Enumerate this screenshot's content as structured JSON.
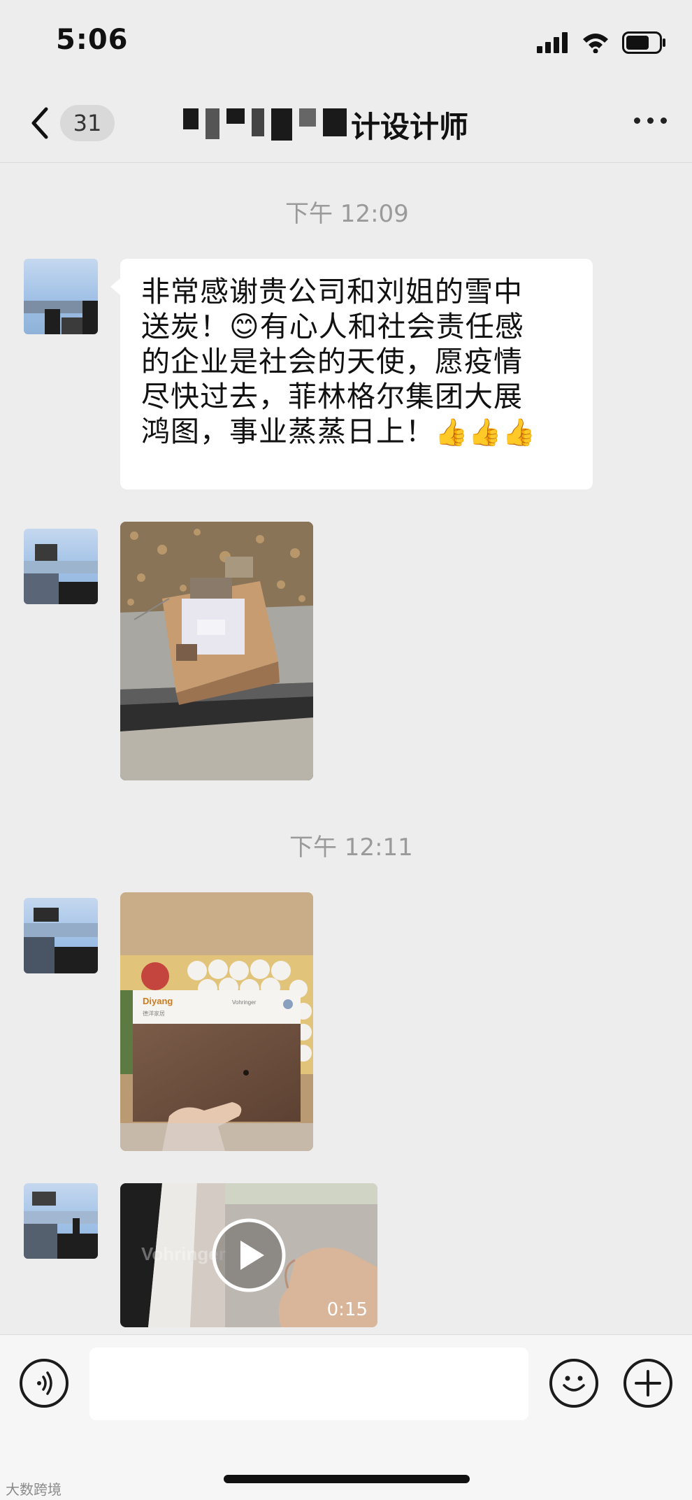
{
  "status_bar": {
    "time": "5:06",
    "icons": [
      "signal-icon",
      "wifi-icon",
      "battery-icon"
    ]
  },
  "nav": {
    "back_badge": "31",
    "title_suffix": "计设计师",
    "more_icon": "more-icon"
  },
  "messages": [
    {
      "type": "timestamp",
      "text": "下午 12:09"
    },
    {
      "type": "text",
      "lines": [
        "非常感谢贵公司和刘姐的雪中",
        "送炭！",
        "有心人和社会责任感",
        "的企业是社会的天使，愿疫情",
        "尽快过去，菲林格尔集团大展",
        "鸿图，事业蒸蒸日上！"
      ],
      "emoji_smile": "😊",
      "thumbs": "👍👍👍"
    },
    {
      "type": "image",
      "description_icon": "photo-package"
    },
    {
      "type": "timestamp",
      "text": "下午 12:11"
    },
    {
      "type": "image",
      "brand_text": "Diyang",
      "brand_sub": "德洋家居",
      "brand_right": "Vohringer"
    },
    {
      "type": "video",
      "duration": "0:15",
      "overlay_text": "Vohringer"
    }
  ],
  "input_bar": {
    "voice_icon": "voice-icon",
    "emoji_icon": "emoji-icon",
    "plus_icon": "plus-icon",
    "value": ""
  },
  "watermark": "大数跨境",
  "colors": {
    "background": "#ededed",
    "bubble": "#ffffff",
    "timestamp": "#9a9a9a"
  }
}
